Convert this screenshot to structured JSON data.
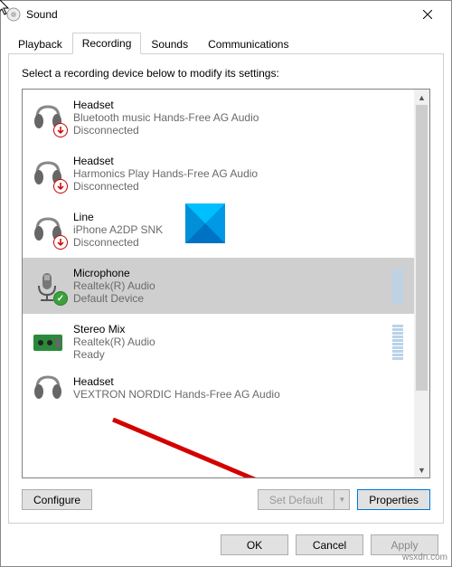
{
  "window": {
    "title": "Sound"
  },
  "tabs": {
    "items": [
      {
        "label": "Playback"
      },
      {
        "label": "Recording"
      },
      {
        "label": "Sounds"
      },
      {
        "label": "Communications"
      }
    ],
    "activeIndex": 1
  },
  "instruction": "Select a recording device below to modify its settings:",
  "devices": [
    {
      "name": "Headset",
      "sub": "Bluetooth music Hands-Free AG Audio",
      "status": "Disconnected"
    },
    {
      "name": "Headset",
      "sub": "Harmonics Play Hands-Free AG Audio",
      "status": "Disconnected"
    },
    {
      "name": "Line",
      "sub": "iPhone A2DP SNK",
      "status": "Disconnected"
    },
    {
      "name": "Microphone",
      "sub": "Realtek(R) Audio",
      "status": "Default Device"
    },
    {
      "name": "Stereo Mix",
      "sub": "Realtek(R) Audio",
      "status": "Ready"
    },
    {
      "name": "Headset",
      "sub": "VEXTRON NORDIC Hands-Free AG Audio",
      "status": ""
    }
  ],
  "buttons": {
    "configure": "Configure",
    "setDefault": "Set Default",
    "properties": "Properties",
    "ok": "OK",
    "cancel": "Cancel",
    "apply": "Apply"
  },
  "watermark": "wsxdn.com",
  "selectedIndex": 3
}
